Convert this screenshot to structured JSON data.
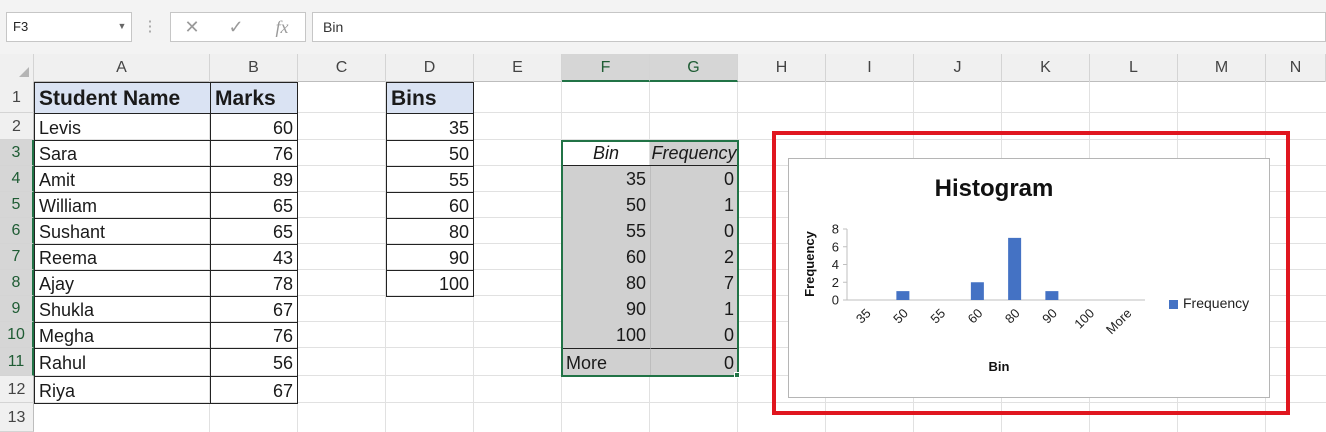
{
  "name_box": "F3",
  "formula_bar": {
    "content": "Bin",
    "fx": "fx"
  },
  "columns": [
    "A",
    "B",
    "C",
    "D",
    "E",
    "F",
    "G",
    "H",
    "I",
    "J",
    "K",
    "L",
    "M",
    "N"
  ],
  "rows": [
    "1",
    "2",
    "3",
    "4",
    "5",
    "6",
    "7",
    "8",
    "9",
    "10",
    "11",
    "12",
    "13"
  ],
  "sheet": {
    "student_header": "Student Name",
    "marks_header": "Marks",
    "bins_header": "Bins",
    "students": [
      {
        "name": "Levis",
        "marks": "60"
      },
      {
        "name": "Sara",
        "marks": "76"
      },
      {
        "name": "Amit",
        "marks": "89"
      },
      {
        "name": "William",
        "marks": "65"
      },
      {
        "name": "Sushant",
        "marks": "65"
      },
      {
        "name": "Reema",
        "marks": "43"
      },
      {
        "name": "Ajay",
        "marks": "78"
      },
      {
        "name": "Shukla",
        "marks": "67"
      },
      {
        "name": "Megha",
        "marks": "76"
      },
      {
        "name": "Rahul",
        "marks": "56"
      },
      {
        "name": "Riya",
        "marks": "67"
      }
    ],
    "bins": [
      "35",
      "50",
      "55",
      "60",
      "80",
      "90",
      "100"
    ],
    "freq_table": {
      "bin_header": "Bin",
      "freq_header": "Frequency",
      "rows": [
        {
          "bin": "35",
          "freq": "0"
        },
        {
          "bin": "50",
          "freq": "1"
        },
        {
          "bin": "55",
          "freq": "0"
        },
        {
          "bin": "60",
          "freq": "2"
        },
        {
          "bin": "80",
          "freq": "7"
        },
        {
          "bin": "90",
          "freq": "1"
        },
        {
          "bin": "100",
          "freq": "0"
        },
        {
          "bin": "More",
          "freq": "0"
        }
      ]
    }
  },
  "chart_data": {
    "type": "bar",
    "title": "Histogram",
    "xlabel": "Bin",
    "ylabel": "Frequency",
    "categories": [
      "35",
      "50",
      "55",
      "60",
      "80",
      "90",
      "100",
      "More"
    ],
    "series": [
      {
        "name": "Frequency",
        "values": [
          0,
          1,
          0,
          2,
          7,
          1,
          0,
          0
        ],
        "color": "#4472c4"
      }
    ],
    "ylim": [
      0,
      8
    ],
    "yticks": [
      "0",
      "2",
      "4",
      "6",
      "8"
    ],
    "legend": "right",
    "grid": false
  },
  "colors": {
    "accent": "#217346",
    "highlight": "#e0161f",
    "bar": "#4472c4",
    "header_fill": "#dae3f3"
  }
}
